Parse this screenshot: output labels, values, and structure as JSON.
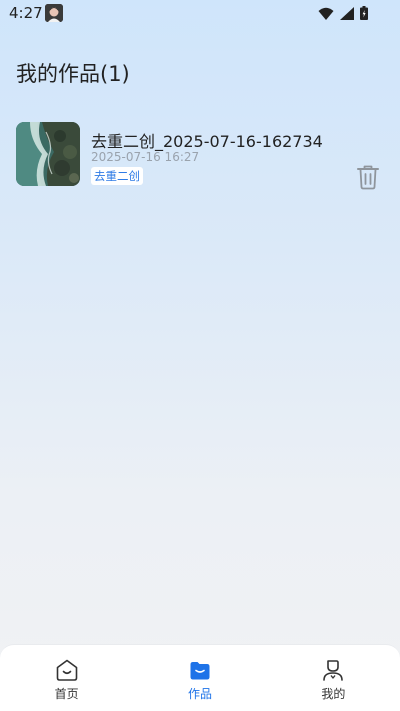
{
  "status": {
    "time": "4:27",
    "icons": [
      "avatar-icon",
      "wifi-icon",
      "signal-icon",
      "battery-icon"
    ]
  },
  "page": {
    "title": "我的作品(1)"
  },
  "works": [
    {
      "title": "去重二创_2025-07-16-162734",
      "date": "2025-07-16 16:27",
      "tag": "去重二创"
    }
  ],
  "tabbar": {
    "tabs": [
      {
        "label": "首页",
        "icon": "home-icon",
        "active": false
      },
      {
        "label": "作品",
        "icon": "works-icon",
        "active": true
      },
      {
        "label": "我的",
        "icon": "profile-icon",
        "active": false
      }
    ]
  },
  "colors": {
    "accent": "#1e73e8",
    "tag_text": "#2e7be6",
    "muted_text": "#9aa3ad"
  }
}
